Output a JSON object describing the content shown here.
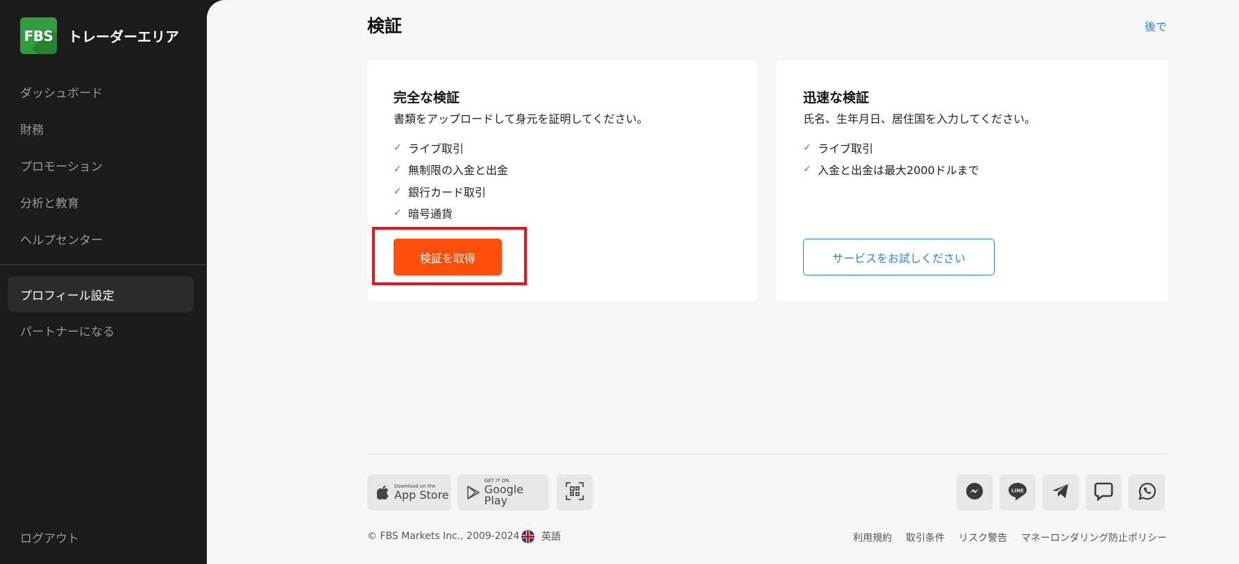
{
  "brand": {
    "logo_text": "FBS",
    "name": "トレーダーエリア"
  },
  "sidebar": {
    "items": [
      {
        "label": "ダッシュボード"
      },
      {
        "label": "財務"
      },
      {
        "label": "プロモーション"
      },
      {
        "label": "分析と教育"
      },
      {
        "label": "ヘルプセンター"
      }
    ],
    "secondary": [
      {
        "label": "プロフィール設定",
        "active": true
      },
      {
        "label": "パートナーになる"
      }
    ],
    "logout": "ログアウト"
  },
  "header": {
    "title": "検証",
    "later": "後で"
  },
  "cards": [
    {
      "title": "完全な検証",
      "description": "書類をアップロードして身元を証明してください。",
      "features": [
        "ライブ取引",
        "無制限の入金と出金",
        "銀行カード取引",
        "暗号通貨"
      ],
      "button": "検証を取得"
    },
    {
      "title": "迅速な検証",
      "description": "氏名、生年月日、居住国を入力してください。",
      "features": [
        "ライブ取引",
        "入金と出金は最大2000ドルまで"
      ],
      "button": "サービスをお試しください"
    }
  ],
  "footer": {
    "app_store": {
      "small": "Download on the",
      "big": "App Store"
    },
    "google_play": {
      "small": "GET IT ON",
      "big": "Google Play"
    },
    "copyright": "© FBS Markets Inc., 2009-2024",
    "language": "英語",
    "links": [
      "利用規約",
      "取引条件",
      "リスク警告",
      "マネーロンダリング防止ポリシー"
    ],
    "social_icons": [
      "messenger-icon",
      "line-icon",
      "telegram-icon",
      "chat-icon",
      "whatsapp-icon"
    ]
  },
  "colors": {
    "accent": "#ff4e0a",
    "link": "#2a84d6",
    "brand": "#2e9e3f",
    "highlight": "#e8141c"
  }
}
